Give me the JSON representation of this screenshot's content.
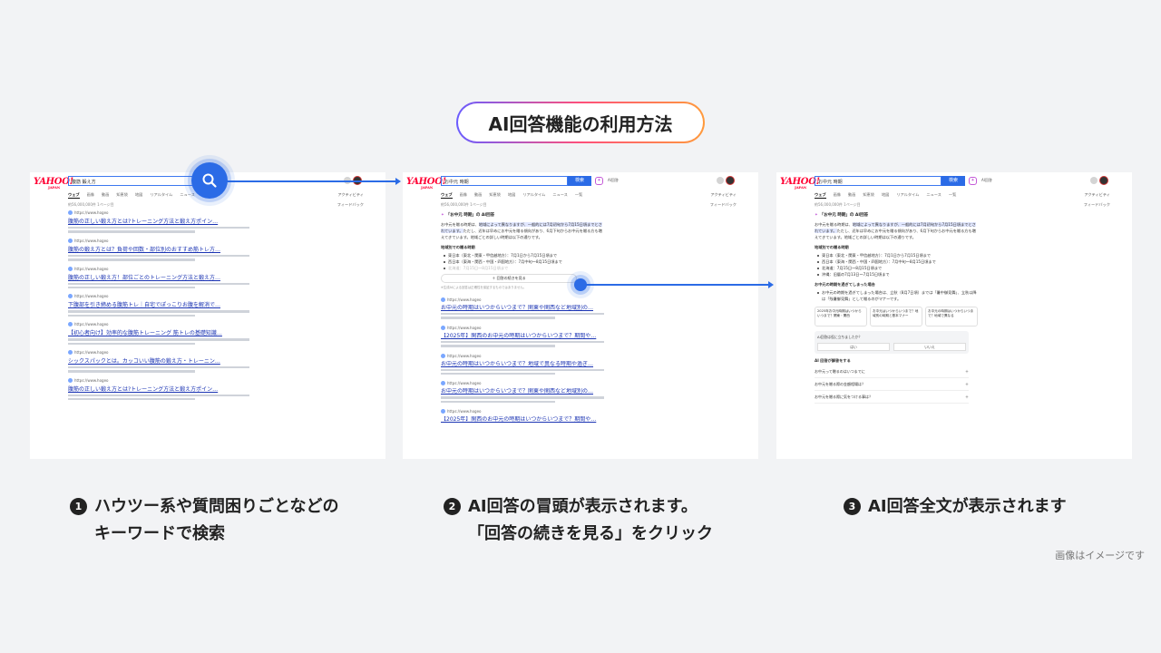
{
  "title": "AI回答機能の利用方法",
  "search": {
    "query": "お中元 時期",
    "button": "検索"
  },
  "brand": {
    "logo": "YAHOO!",
    "sub": "JAPAN"
  },
  "tabs": [
    "ウェブ",
    "画像",
    "動画",
    "知恵袋",
    "地図",
    "リアルタイム",
    "ニュース",
    "一覧"
  ],
  "side_links": [
    "アクティビティ",
    "フィードバック"
  ],
  "ai_label": "AI回答",
  "result_count": "約56,000,000件 1ページ目",
  "panel1": {
    "query": "腹筋 鍛え方",
    "results": [
      {
        "url": "https://www.hogeo",
        "title": "腹筋の正しい鍛え方とは?トレーニング方法と鍛え方ポイン…"
      },
      {
        "url": "https://www.hogeo",
        "title": "腹筋の鍛え方とは？負荷や回数・部位別のおすすめ筋トレ方…"
      },
      {
        "url": "https://www.hogeo",
        "title": "腹筋の正しい鍛え方！部位ごとのトレーニング方法と鍛え方…"
      },
      {
        "url": "https://www.hogeo",
        "title": "下腹部を引き締める腹筋トレ｜自宅でぽっこりお腹を解消で…"
      },
      {
        "url": "https://www.hogeo",
        "title": "【初心者向け】効率的な腹筋トレーニング 筋トレの基礎知識…"
      },
      {
        "url": "https://www.hogeo",
        "title": "シックスパックとは。カッコいい腹筋の鍛え方・トレーニン…"
      },
      {
        "url": "https://www.hogeo",
        "title": "腹筋の正しい鍛え方とは?トレーニング方法と鍛え方ポイン…"
      }
    ]
  },
  "panel2": {
    "ai_head": "「お中元 時期」の AI回答",
    "intro_a": "お中元を贈る時期は、",
    "intro_hl": "地域によって異なりますが、一般的には7月初旬から7月15日頃までとされています。",
    "intro_b": "ただし、近年は早めにお中元を贈る傾向があり、6月下旬からお中元を贈る方も増えてきています。地域ごとの詳しい時期は以下の通りです。",
    "sub": "地域別での贈る時期",
    "bullets": [
      "東日本（東北・関東・甲信越地方）：7月1日から7月15日頃まで",
      "西日本（東海・関西・中国・四国地方）：7月中旬〜8月15日頃まで",
      "北海道：7月15日〜8月15日頃まで"
    ],
    "more_button": "＋ 回答の続きを見る",
    "note": "※生成AIによる回答は正確性を保証するものではありません。",
    "results": [
      {
        "url": "https://www.hogeo",
        "title": "お中元の時期はいつからいつまで？関東や関西など地域別の…"
      },
      {
        "url": "https://www.hogeo",
        "title": "【2025年】関西のお中元の時期はいつからいつまで？期間や…"
      },
      {
        "url": "https://www.hogeo",
        "title": "お中元の時期はいつからいつまで？地域で異なる時期や過ぎ…"
      },
      {
        "url": "https://www.hogeo",
        "title": "お中元の時期はいつからいつまで？関東や関西など地域別の…"
      },
      {
        "url": "https://www.hogeo",
        "title": "【2025年】関西のお中元の時期はいつからいつまで？期間や…"
      }
    ]
  },
  "panel3": {
    "bullets": [
      "東日本（東北・関東・甲信越地方）：7月1日から7月15日頃まで",
      "西日本（東海・関西・中国・四国地方）：7月中旬〜8月15日頃まで",
      "北海道：7月15日〜8月15日頃まで",
      "沖縄：旧暦の7月13日〜7月15日頃まで"
    ],
    "sub2": "お中元の時期を過ぎてしまった場合",
    "late": "お中元の時期を過ぎてしまった場合は、立秋（8月7日頃）までは「暑中御見舞」、立秋以降は「残暑御見舞」として贈るのがマナーです。",
    "cards": [
      "2025年お中元時期はいつからいつまで？関東・関西",
      "お中元はいつからいつまで？地域別の時期と基本マナー",
      "お中元の時期はいつからいつまで？地域で異なる"
    ],
    "feedback": "AI回答は役に立ちましたか？",
    "yes": "はい",
    "no": "いいえ",
    "faq_head": "AI 回答が解答をする",
    "faqs": [
      "お中元って贈るのはいつまでに",
      "お中元を贈る際の金額相場は？",
      "お中元を贈る際に気をつける事は？"
    ]
  },
  "steps": [
    {
      "num": "1",
      "l1": "ハウツー系や質問困りごとなどの",
      "l2": "キーワードで検索"
    },
    {
      "num": "2",
      "l1": "AI回答の冒頭が表示されます。",
      "l2": "「回答の続きを見る」をクリック"
    },
    {
      "num": "3",
      "l1": "AI回答全文が表示されます",
      "l2": ""
    }
  ],
  "footnote": "画像はイメージです",
  "colors": {
    "accent": "#2b6be6",
    "link": "#1a33b3",
    "brand": "#ff0033"
  }
}
